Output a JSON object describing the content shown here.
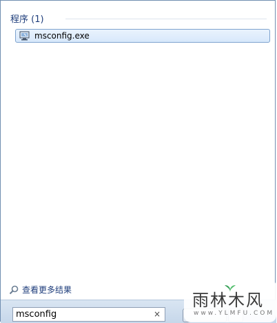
{
  "results": {
    "section_title": "程序 (1)",
    "items": [
      {
        "label": "msconfig.exe",
        "icon": "system-config-icon"
      }
    ]
  },
  "more_results": {
    "label": "查看更多结果",
    "icon": "search-icon"
  },
  "search": {
    "value": "msconfig",
    "clear_symbol": "×"
  },
  "watermark": {
    "main": "雨林木风",
    "sub": "www.YLMFU.COM"
  }
}
